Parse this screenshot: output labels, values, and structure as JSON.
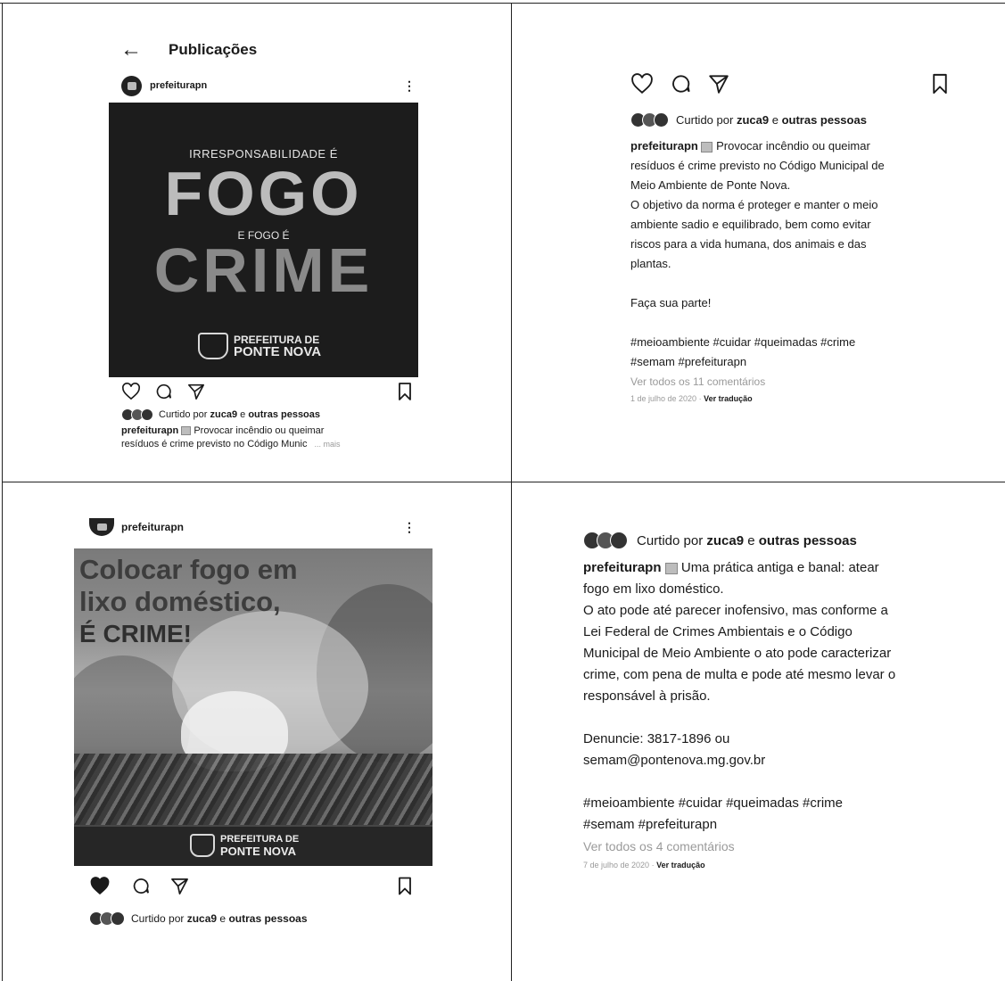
{
  "header": {
    "back_label": "←",
    "title": "Publicações"
  },
  "post1": {
    "username": "prefeiturapn",
    "more": "⋮",
    "image_text": {
      "line1": "IRRESPONSABILIDADE É",
      "line2": "FOGO",
      "line3": "E FOGO É",
      "line4": "CRIME",
      "logo1": "PREFEITURA DE",
      "logo2": "PONTE NOVA"
    },
    "likes_prefix": "Curtido por",
    "likes_user": "zuca9",
    "likes_and": "e",
    "likes_others": "outras pessoas",
    "caption_user": "prefeiturapn",
    "caption_preview_1": "Provocar incêndio ou queimar",
    "caption_preview_2": "resíduos é crime previsto no Código Munic",
    "caption_more": "... mais"
  },
  "post1_detail": {
    "likes_prefix": "Curtido por",
    "likes_user": "zuca9",
    "likes_and": "e",
    "likes_others": "outras pessoas",
    "caption_user": "prefeiturapn",
    "caption_first": "Provocar incêndio ou queimar",
    "caption_lines": [
      "resíduos é crime previsto no Código Municipal de",
      "Meio Ambiente de Ponte Nova.",
      "O objetivo da norma é proteger e manter o meio",
      "ambiente sadio e equilibrado, bem como evitar",
      "riscos para a vida humana, dos animais e das",
      "plantas."
    ],
    "cta": "Faça sua parte!",
    "hashtags_1": "#meioambiente #cuidar #queimadas #crime",
    "hashtags_2": "#semam #prefeiturapn",
    "comments": "Ver todos os 11 comentários",
    "date": "1 de julho de 2020",
    "separator": " · ",
    "translate": "Ver tradução"
  },
  "post2": {
    "username": "prefeiturapn",
    "more": "⋮",
    "image_text": {
      "line1": "Colocar fogo em",
      "line2": "lixo doméstico,",
      "line3": "É CRIME!",
      "logo1": "PREFEITURA DE",
      "logo2": "PONTE NOVA"
    },
    "likes_prefix": "Curtido por",
    "likes_user": "zuca9",
    "likes_and": "e",
    "likes_others": "outras pessoas"
  },
  "post2_detail": {
    "likes_prefix": "Curtido por",
    "likes_user": "zuca9",
    "likes_and": "e",
    "likes_others": "outras pessoas",
    "caption_user": "prefeiturapn",
    "caption_first": "Uma prática antiga e banal: atear",
    "caption_lines": [
      "fogo em lixo doméstico.",
      "O ato pode até parecer inofensivo, mas conforme a",
      "Lei Federal de Crimes Ambientais e o Código",
      "Municipal de Meio Ambiente o ato pode caracterizar",
      "crime, com pena de multa e pode até mesmo levar o",
      "responsável à prisão."
    ],
    "contact_1": "Denuncie: 3817-1896 ou",
    "contact_2": "semam@pontenova.mg.gov.br",
    "hashtags_1": "#meioambiente #cuidar #queimadas #crime",
    "hashtags_2": "#semam #prefeiturapn",
    "comments": "Ver todos os 4 comentários",
    "date": "7 de julho de 2020",
    "separator": " · ",
    "translate": "Ver tradução"
  }
}
